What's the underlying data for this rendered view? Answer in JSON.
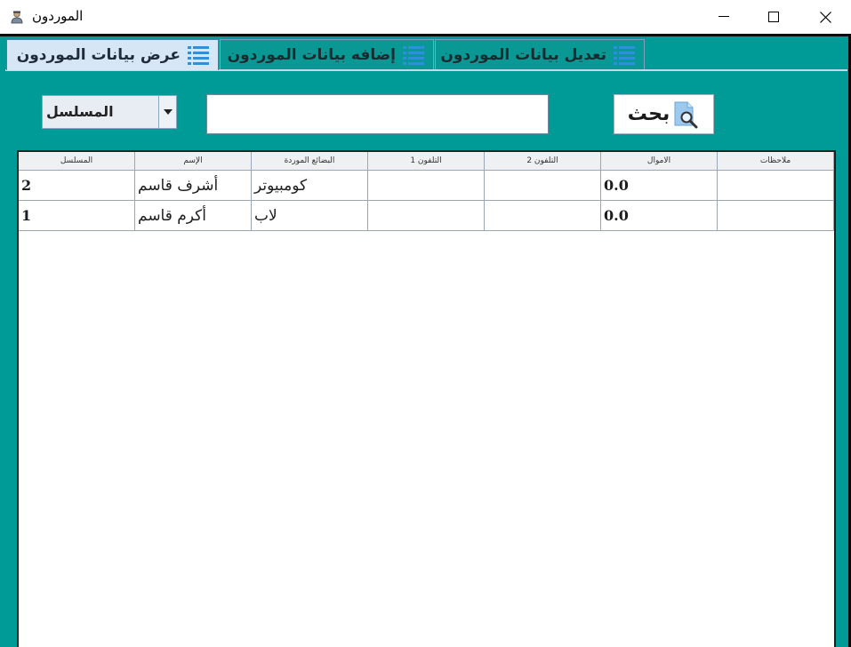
{
  "window": {
    "title": "الموردون",
    "icon": "user-icon"
  },
  "tabs": [
    {
      "label": "عرض بيانات الموردون",
      "icon": "list-icon",
      "active": true
    },
    {
      "label": "إضافه بيانات الموردون",
      "icon": "list-icon",
      "active": false
    },
    {
      "label": "تعديل بيانات الموردون",
      "icon": "list-icon",
      "active": false
    }
  ],
  "search": {
    "field_selected": "المسلسل",
    "input_value": "",
    "button_label": "بحث",
    "button_icon": "search-document-icon"
  },
  "table": {
    "columns": [
      "المسلسل",
      "الإسم",
      "البضائع الموردة",
      "التلفون 1",
      "التلفون 2",
      "الاموال",
      "ملاحظات"
    ],
    "rows": [
      {
        "serial": "2",
        "name": "أشرف قاسم",
        "goods": "كومبيوتر",
        "phone1": "",
        "phone2": "",
        "money": "0.0",
        "notes": ""
      },
      {
        "serial": "1",
        "name": "أكرم قاسم",
        "goods": "لاب",
        "phone1": "",
        "phone2": "",
        "money": "0.0",
        "notes": ""
      }
    ]
  },
  "colors": {
    "frame": "#009a97",
    "active_tab": "#d7e6f4",
    "icon_blue": "#2f8fd8"
  }
}
